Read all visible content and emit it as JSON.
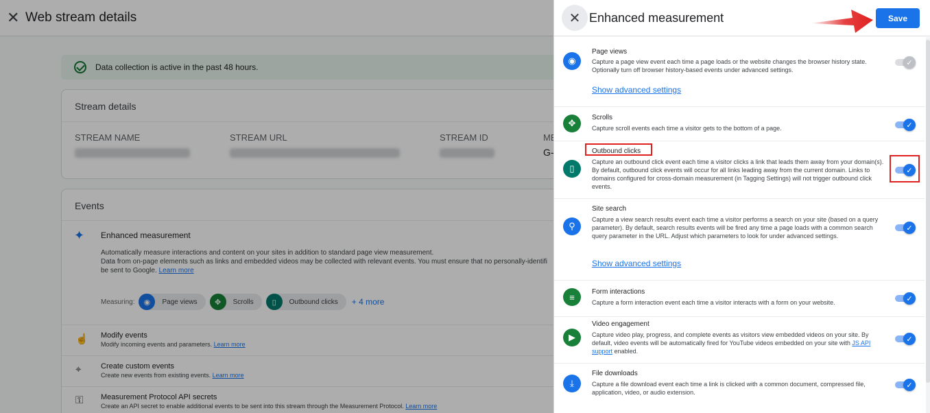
{
  "background": {
    "header": {
      "close_icon": "close-icon",
      "title": "Web stream details"
    },
    "banner": {
      "text": "Data collection is active in the past 48 hours."
    },
    "stream_details": {
      "heading": "Stream details",
      "columns": [
        {
          "label": "STREAM NAME"
        },
        {
          "label": "STREAM URL"
        },
        {
          "label": "STREAM ID"
        },
        {
          "label": "ME",
          "value": "G-"
        }
      ]
    },
    "events": {
      "heading": "Events",
      "enhanced": {
        "title": "Enhanced measurement",
        "desc1": "Automatically measure interactions and content on your sites in addition to standard page view measurement.",
        "desc2": "Data from on-page elements such as links and embedded videos may be collected with relevant events. You must ensure that no personally-identifi",
        "desc3": "be sent to Google.",
        "learn_more": "Learn more",
        "measuring_label": "Measuring:",
        "chips": [
          "Page views",
          "Scrolls",
          "Outbound clicks"
        ],
        "more": "+ 4 more"
      },
      "rows": [
        {
          "title": "Modify events",
          "desc": "Modify incoming events and parameters.",
          "link": "Learn more"
        },
        {
          "title": "Create custom events",
          "desc": "Create new events from existing events.",
          "link": "Learn more"
        },
        {
          "title": "Measurement Protocol API secrets",
          "desc": "Create an API secret to enable additional events to be sent into this stream through the Measurement Protocol.",
          "link": "Learn more"
        }
      ]
    }
  },
  "panel": {
    "title": "Enhanced measurement",
    "save_label": "Save",
    "colors": {
      "accent": "#1a73e8",
      "highlight": "#e0201f"
    },
    "rows": [
      {
        "title": "Page views",
        "desc": "Capture a page view event each time a page loads or the website changes the browser history state. Optionally turn off browser history-based events under advanced settings.",
        "link": "Show advanced settings",
        "toggle": "disabled-on",
        "icon": "eye-icon"
      },
      {
        "title": "Scrolls",
        "desc": "Capture scroll events each time a visitor gets to the bottom of a page.",
        "toggle": "on",
        "icon": "scroll-icon"
      },
      {
        "title": "Outbound clicks",
        "desc": "Capture an outbound click event each time a visitor clicks a link that leads them away from your domain(s). By default, outbound click events will occur for all links leading away from the current domain. Links to domains configured for cross-domain measurement (in Tagging Settings) will not trigger outbound click events.",
        "toggle": "on",
        "icon": "mouse-icon",
        "highlighted": true
      },
      {
        "title": "Site search",
        "desc": "Capture a view search results event each time a visitor performs a search on your site (based on a query parameter). By default, search results events will be fired any time a page loads with a common search query parameter in the URL. Adjust which parameters to look for under advanced settings.",
        "link": "Show advanced settings",
        "toggle": "on",
        "icon": "search-icon"
      },
      {
        "title": "Form interactions",
        "desc": "Capture a form interaction event each time a visitor interacts with a form on your website.",
        "toggle": "on",
        "icon": "form-icon"
      },
      {
        "title": "Video engagement",
        "desc_pre": "Capture video play, progress, and complete events as visitors view embedded videos on your site. By default, video events will be automatically fired for YouTube videos embedded on your site with",
        "desc_link": "JS API support",
        "desc_post": "enabled.",
        "toggle": "on",
        "icon": "play-icon"
      },
      {
        "title": "File downloads",
        "desc": "Capture a file download event each time a link is clicked with a common document, compressed file, application, video, or audio extension.",
        "toggle": "on",
        "icon": "download-icon"
      }
    ]
  }
}
